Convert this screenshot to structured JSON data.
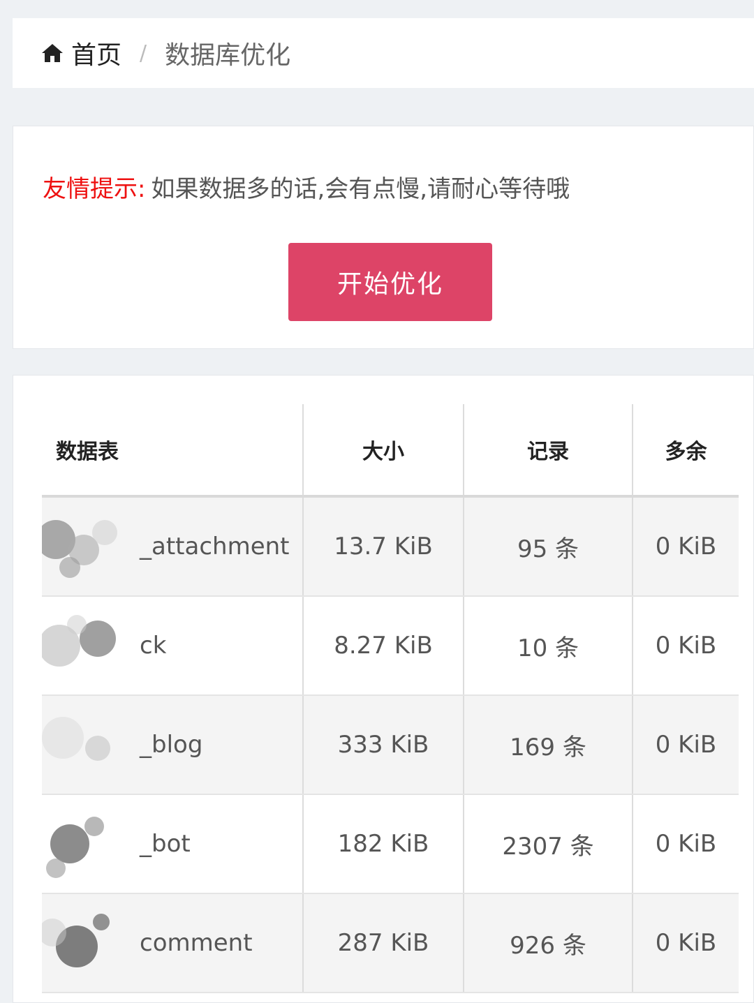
{
  "breadcrumb": {
    "home_icon": "home-icon",
    "home_label": "首页",
    "separator": "/",
    "current": "数据库优化"
  },
  "panel": {
    "tip_label": "友情提示:",
    "tip_text": "如果数据多的话,会有点慢,请耐心等待哦",
    "start_button": "开始优化",
    "button_color": "#dd4467",
    "tip_color": "#ee1111"
  },
  "table": {
    "headers": [
      "数据表",
      "大小",
      "记录",
      "多余"
    ],
    "rows": [
      {
        "name": "_attachment",
        "size": "13.7 KiB",
        "records": "95 条",
        "overhead": "0 KiB"
      },
      {
        "name": "ck",
        "size": "8.27 KiB",
        "records": "10 条",
        "overhead": "0 KiB"
      },
      {
        "name": "_blog",
        "size": "333 KiB",
        "records": "169 条",
        "overhead": "0 KiB"
      },
      {
        "name": "_bot",
        "size": "182 KiB",
        "records": "2307 条",
        "overhead": "0 KiB"
      },
      {
        "name": "comment",
        "size": "287 KiB",
        "records": "926 条",
        "overhead": "0 KiB"
      }
    ]
  }
}
